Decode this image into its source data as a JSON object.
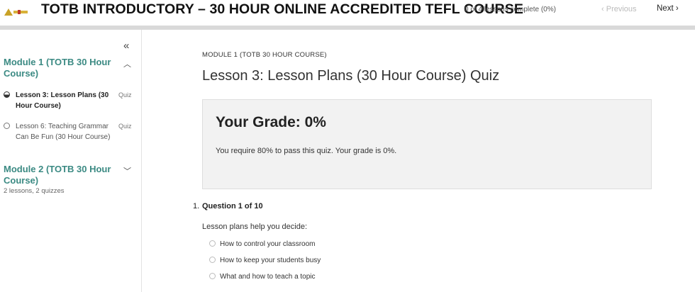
{
  "header": {
    "course_title": "TOTB INTRODUCTORY – 30 HOUR ONLINE ACCREDITED TEFL COURSE",
    "progress_text": "0 of 4 lessons complete (0%)",
    "previous_label": "Previous",
    "next_label": "Next"
  },
  "sidebar": {
    "modules": [
      {
        "title": "Module 1 (TOTB 30 Hour Course)",
        "expanded": true,
        "lessons": [
          {
            "name": "Lesson 3: Lesson Plans (30 Hour Course)",
            "type": "Quiz",
            "active": true
          },
          {
            "name": "Lesson 6: Teaching Grammar Can Be Fun (30 Hour Course)",
            "type": "Quiz",
            "active": false
          }
        ]
      },
      {
        "title": "Module 2 (TOTB 30 Hour Course)",
        "expanded": false,
        "meta": "2 lessons, 2 quizzes"
      }
    ]
  },
  "main": {
    "breadcrumb": "MODULE 1 (TOTB 30 HOUR COURSE)",
    "lesson_title": "Lesson 3: Lesson Plans (30 Hour Course) Quiz",
    "grade": {
      "heading": "Your Grade: 0%",
      "text": "You require 80% to pass this quiz. Your grade is 0%."
    },
    "question": {
      "number": "1.",
      "label": "Question 1 of 10",
      "text": "Lesson plans help you decide:",
      "answers": [
        "How to control your classroom",
        "How to keep your students busy",
        "What and how to teach a topic"
      ]
    }
  },
  "colors": {
    "accent": "#3b8a83",
    "grade_box_bg": "#f2f2f2",
    "progress_strip": "#d9d9d9"
  },
  "icons": {
    "collapse": "double-chevron-left-icon",
    "module_expanded": "chevron-up-icon",
    "module_collapsed": "chevron-down-icon",
    "previous": "chevron-left-icon",
    "next": "chevron-right-icon"
  }
}
